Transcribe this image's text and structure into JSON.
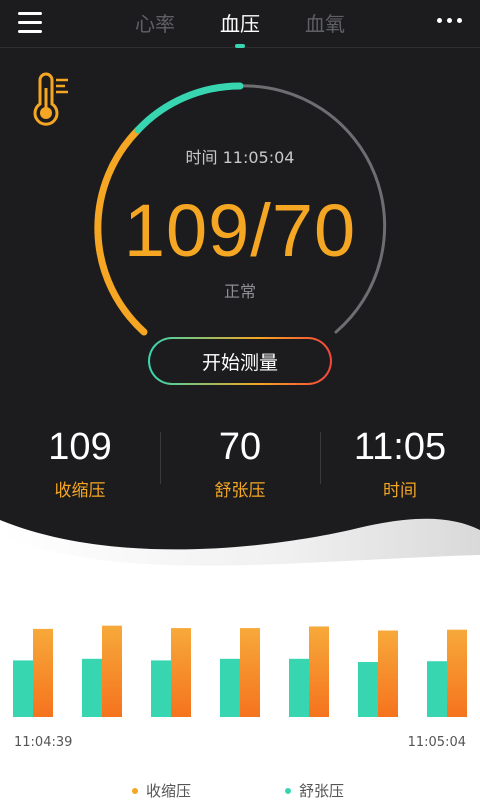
{
  "header": {
    "tabs": [
      {
        "label": "心率",
        "active": false
      },
      {
        "label": "血压",
        "active": true
      },
      {
        "label": "血氧",
        "active": false
      }
    ]
  },
  "measurement": {
    "time_text": "时间 11:05:04",
    "reading": "109/70",
    "status": "正常",
    "start_button": "开始测量"
  },
  "stats": [
    {
      "value": "109",
      "label": "收缩压"
    },
    {
      "value": "70",
      "label": "舒张压"
    },
    {
      "value": "11:05",
      "label": "时间"
    }
  ],
  "colors": {
    "accent_orange": "#f5a623",
    "accent_teal": "#37d6b1",
    "accent_red": "#f5463c",
    "dark_bg": "#1c1c1e"
  },
  "icons": [
    "menu-icon",
    "more-icon",
    "thermometer-icon"
  ],
  "chart_data": {
    "type": "bar",
    "categories": [
      "1",
      "2",
      "3",
      "4",
      "5",
      "6",
      "7"
    ],
    "series": [
      {
        "name": "舒张压",
        "color": "#37d6b1",
        "values": [
          70,
          72,
          70,
          72,
          72,
          68,
          69
        ]
      },
      {
        "name": "收缩压",
        "color": "#f5a623",
        "values": [
          109,
          113,
          110,
          110,
          112,
          107,
          108
        ]
      }
    ],
    "x_start_label": "11:04:39",
    "x_end_label": "11:05:04",
    "ylim": [
      0,
      120
    ],
    "grid": false,
    "legend": "bottom",
    "legend_entries": [
      "收缩压",
      "舒张压"
    ]
  }
}
